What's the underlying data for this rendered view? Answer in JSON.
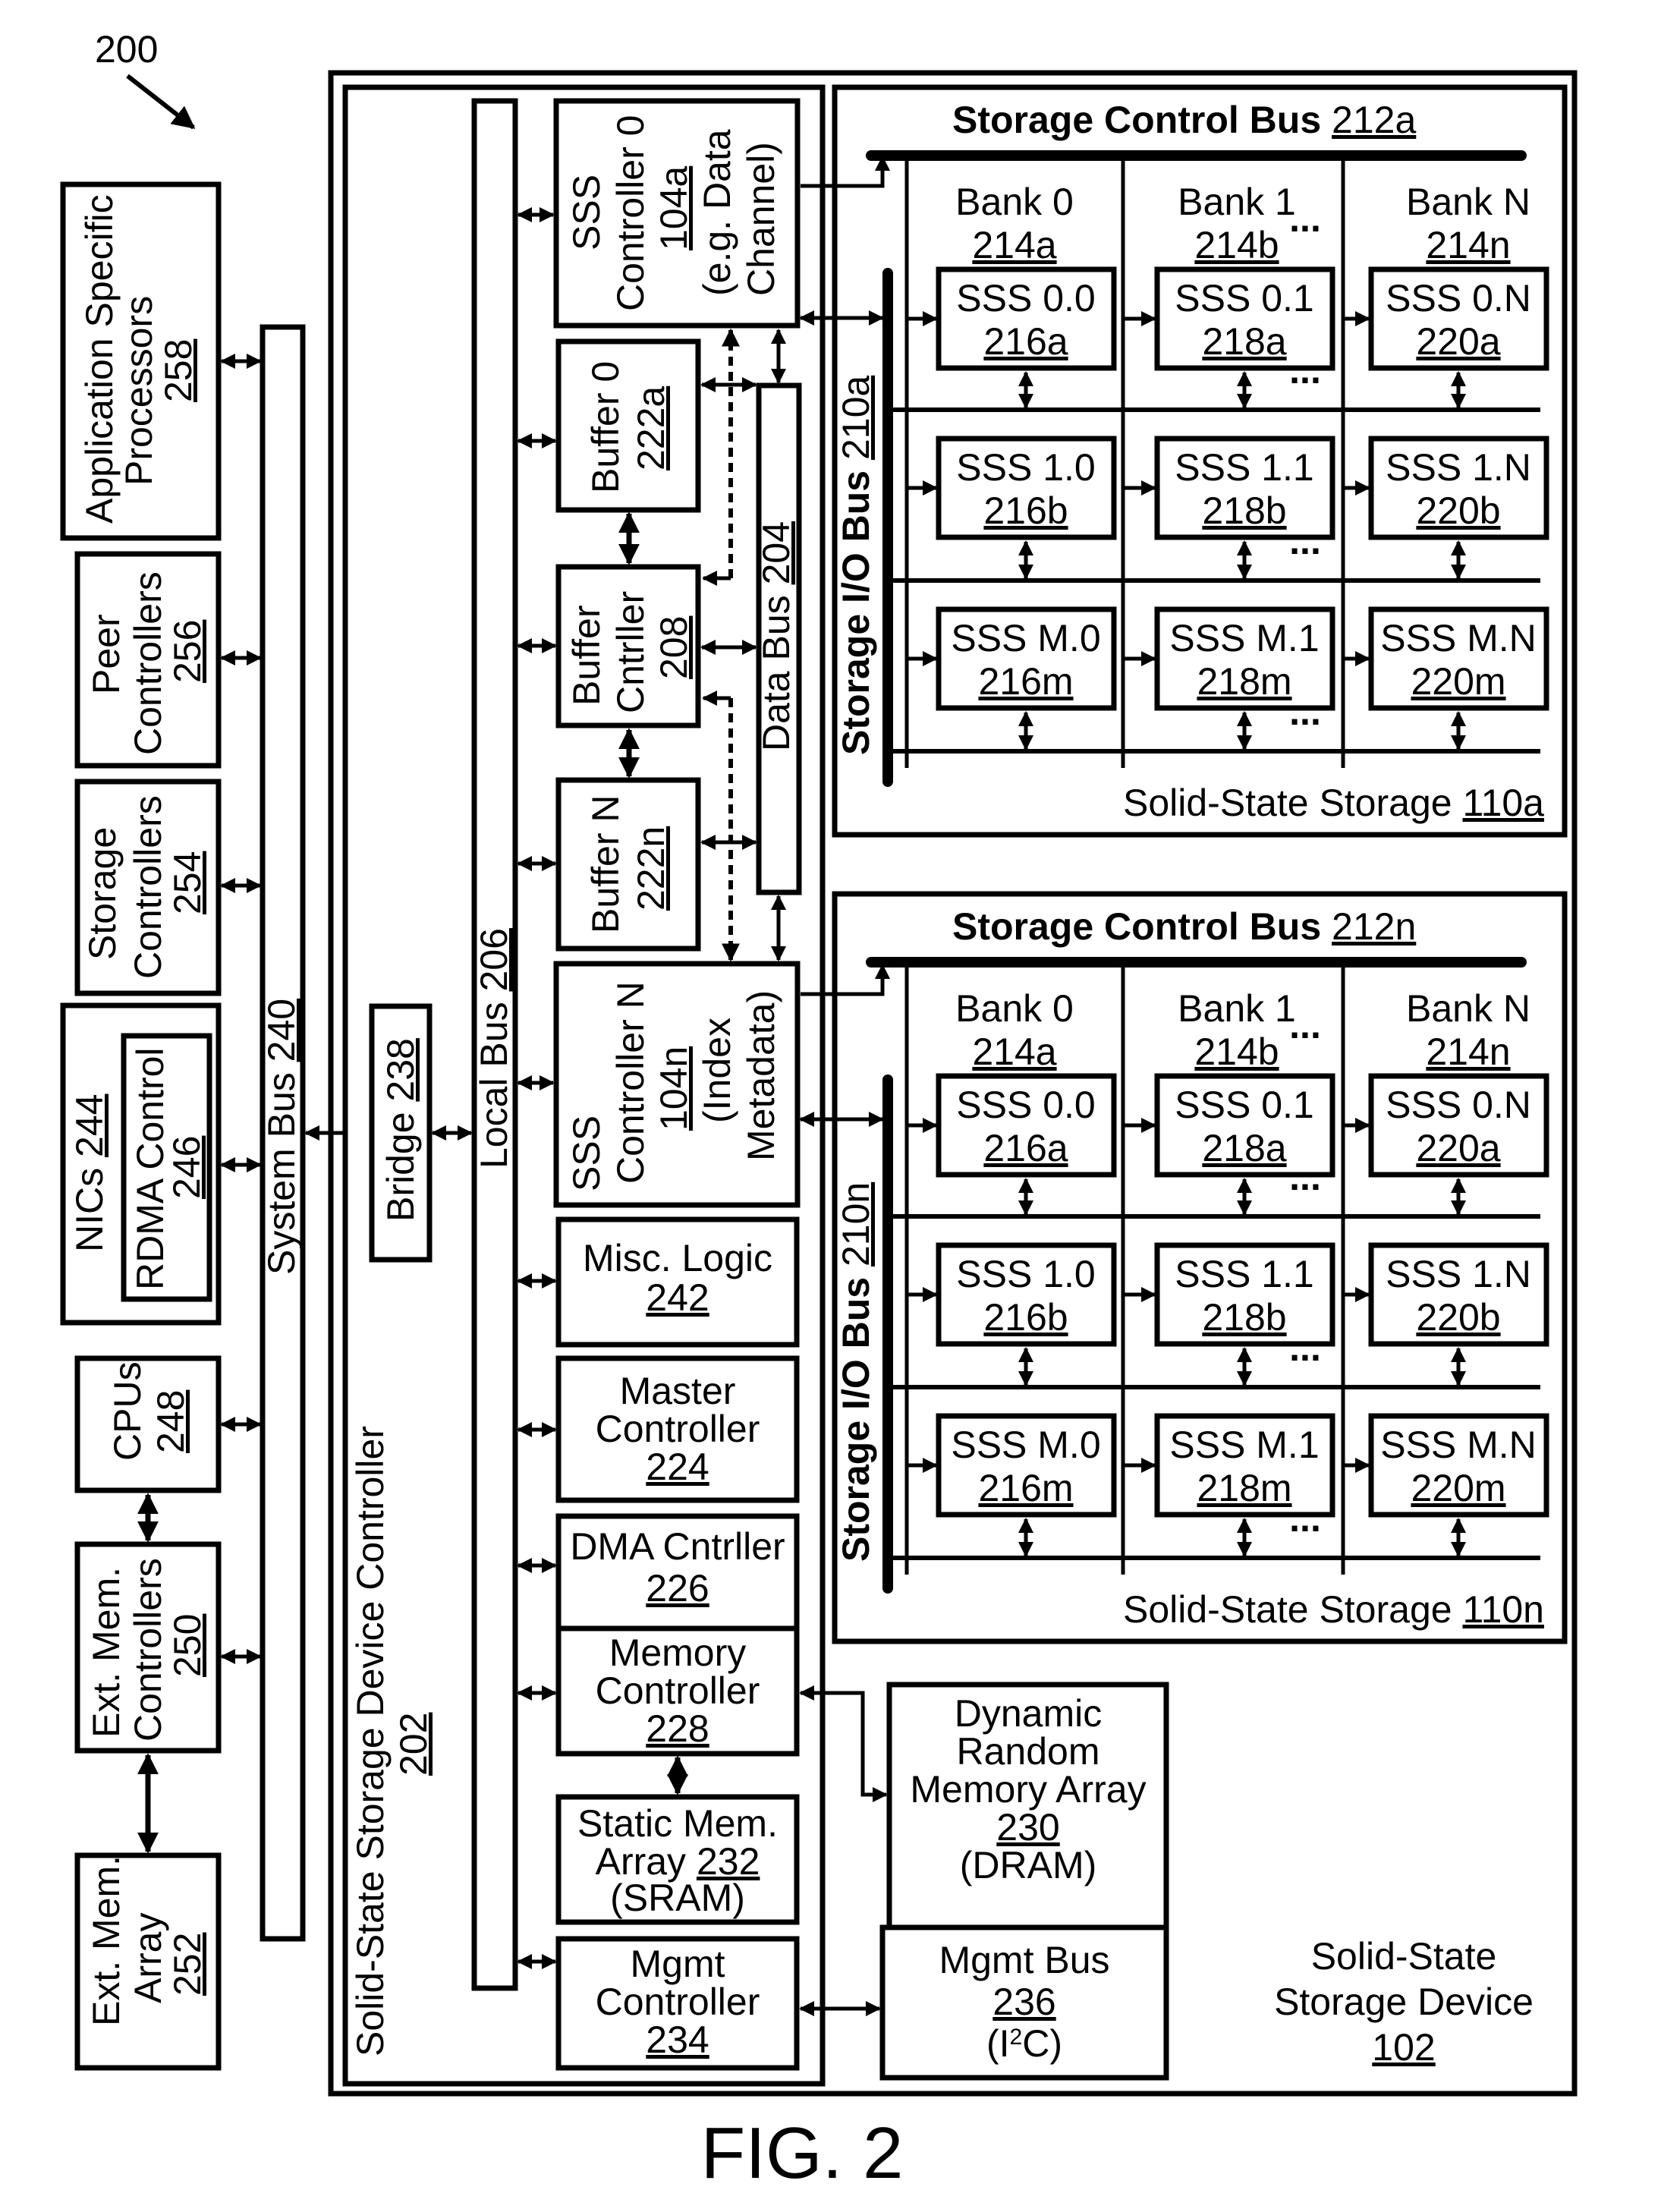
{
  "figure": {
    "ref": "200",
    "caption": "FIG. 2"
  },
  "host": {
    "system_bus": {
      "label": "System Bus",
      "ref": "240"
    },
    "components": [
      {
        "id": "asp",
        "lines": [
          "Application Specific",
          "Processors"
        ],
        "ref": "258"
      },
      {
        "id": "peer",
        "lines": [
          "Peer",
          "Controllers"
        ],
        "ref": "256"
      },
      {
        "id": "stor",
        "lines": [
          "Storage",
          "Controllers"
        ],
        "ref": "254"
      },
      {
        "id": "nics",
        "lines": [
          "NICs"
        ],
        "ref": "244",
        "inner": {
          "label": "RDMA Control",
          "ref": "246"
        }
      },
      {
        "id": "cpus",
        "lines": [
          "CPUs"
        ],
        "ref": "248"
      },
      {
        "id": "extmc",
        "lines": [
          "Ext. Mem.",
          "Controllers"
        ],
        "ref": "250"
      },
      {
        "id": "extma",
        "lines": [
          "Ext. Mem.",
          "Array"
        ],
        "ref": "252"
      }
    ]
  },
  "device": {
    "label_lines": [
      "Solid-State",
      "Storage Device"
    ],
    "ref": "102",
    "controller": {
      "label": "Solid-State Storage Device Controller",
      "ref": "202",
      "bridge": {
        "label": "Bridge",
        "ref": "238"
      },
      "local_bus": {
        "label": "Local Bus",
        "ref": "206"
      },
      "data_bus": {
        "label": "Data Bus",
        "ref": "204"
      },
      "ssc0": {
        "lines": [
          "SSS",
          "Controller 0"
        ],
        "ref": "104a",
        "note": [
          "(e.g. Data",
          "Channel)"
        ]
      },
      "sscn": {
        "lines": [
          "SSS",
          "Controller N"
        ],
        "ref": "104n",
        "note": [
          "(Index",
          "Metadata)"
        ]
      },
      "buffer0": {
        "label": "Buffer 0",
        "ref": "222a"
      },
      "bufctl": {
        "lines": [
          "Buffer",
          "Cntrller"
        ],
        "ref": "208"
      },
      "buffern": {
        "label": "Buffer N",
        "ref": "222n"
      },
      "misc": {
        "label": "Misc. Logic",
        "ref": "242"
      },
      "master": {
        "lines": [
          "Master",
          "Controller"
        ],
        "ref": "224"
      },
      "dma": {
        "label": "DMA Cntrller",
        "ref": "226"
      },
      "memctl": {
        "lines": [
          "Memory",
          "Controller"
        ],
        "ref": "228"
      },
      "sram": {
        "line1": "Static Mem.",
        "line2": "Array",
        "ref": "232",
        "note": "(SRAM)"
      },
      "mgmtctl": {
        "lines": [
          "Mgmt",
          "Controller"
        ],
        "ref": "234"
      }
    },
    "dram": {
      "lines": [
        "Dynamic",
        "Random",
        "Memory Array"
      ],
      "ref": "230",
      "note": "(DRAM)"
    },
    "mgmt_bus": {
      "label": "Mgmt Bus",
      "ref": "236",
      "note_prefix": "(I",
      "note_sup": "2",
      "note_suffix": "C)"
    },
    "storages": [
      {
        "label": "Solid-State Storage",
        "ref": "110a",
        "control_bus": {
          "label": "Storage Control Bus",
          "ref": "212a"
        },
        "io_bus": {
          "label": "Storage I/O Bus",
          "ref": "210a"
        },
        "banks": [
          {
            "label": "Bank 0",
            "ref": "214a"
          },
          {
            "label": "Bank 1",
            "ref": "214b"
          },
          {
            "label": "Bank N",
            "ref": "214n"
          }
        ],
        "cells": [
          [
            {
              "label": "SSS 0.0",
              "ref": "216a"
            },
            {
              "label": "SSS 0.1",
              "ref": "218a"
            },
            {
              "label": "SSS 0.N",
              "ref": "220a"
            }
          ],
          [
            {
              "label": "SSS 1.0",
              "ref": "216b"
            },
            {
              "label": "SSS 1.1",
              "ref": "218b"
            },
            {
              "label": "SSS 1.N",
              "ref": "220b"
            }
          ],
          [
            {
              "label": "SSS M.0",
              "ref": "216m"
            },
            {
              "label": "SSS M.1",
              "ref": "218m"
            },
            {
              "label": "SSS M.N",
              "ref": "220m"
            }
          ]
        ]
      },
      {
        "label": "Solid-State Storage",
        "ref": "110n",
        "control_bus": {
          "label": "Storage Control Bus",
          "ref": "212n"
        },
        "io_bus": {
          "label": "Storage I/O Bus",
          "ref": "210n"
        },
        "banks": [
          {
            "label": "Bank 0",
            "ref": "214a"
          },
          {
            "label": "Bank 1",
            "ref": "214b"
          },
          {
            "label": "Bank N",
            "ref": "214n"
          }
        ],
        "cells": [
          [
            {
              "label": "SSS 0.0",
              "ref": "216a"
            },
            {
              "label": "SSS 0.1",
              "ref": "218a"
            },
            {
              "label": "SSS 0.N",
              "ref": "220a"
            }
          ],
          [
            {
              "label": "SSS 1.0",
              "ref": "216b"
            },
            {
              "label": "SSS 1.1",
              "ref": "218b"
            },
            {
              "label": "SSS 1.N",
              "ref": "220b"
            }
          ],
          [
            {
              "label": "SSS M.0",
              "ref": "216m"
            },
            {
              "label": "SSS M.1",
              "ref": "218m"
            },
            {
              "label": "SSS M.N",
              "ref": "220m"
            }
          ]
        ]
      }
    ],
    "ellipsis": "..."
  }
}
